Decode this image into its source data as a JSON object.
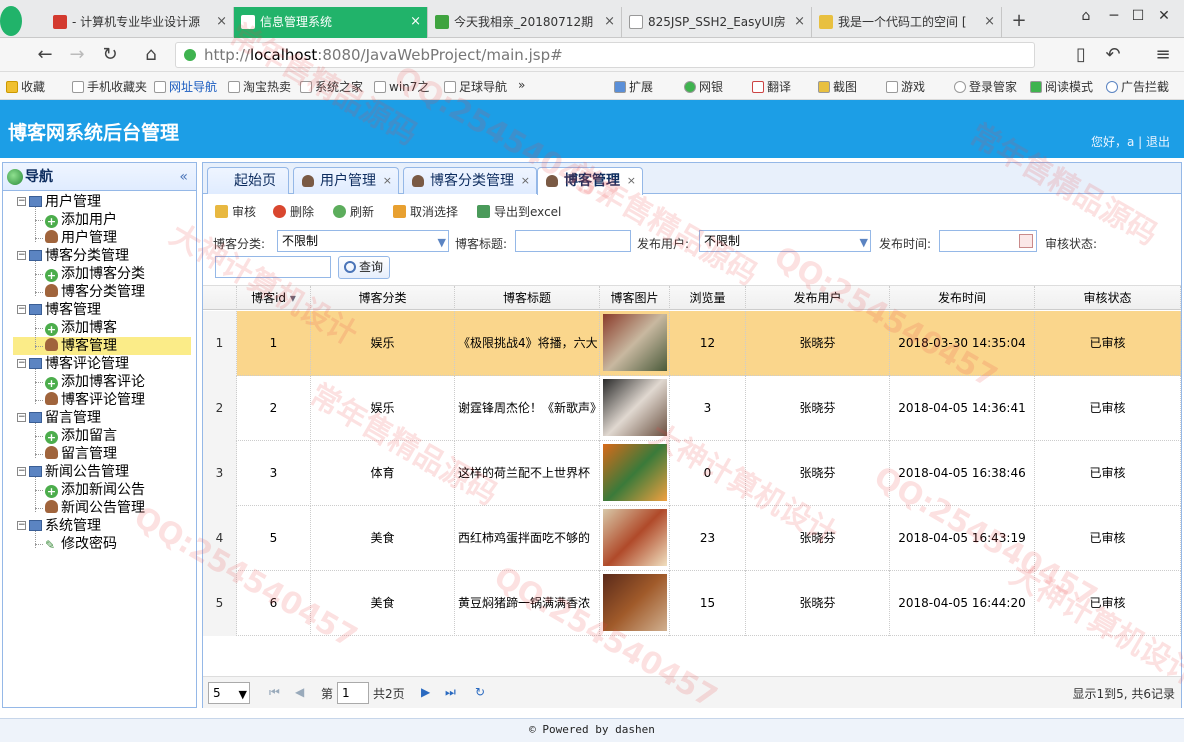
{
  "browser": {
    "tabs": [
      {
        "label": "- 计算机专业毕业设计源",
        "icon_color": "#d33a2f"
      },
      {
        "label": "信息管理系统",
        "icon_color": "#ffffff"
      },
      {
        "label": "今天我相亲_20180712期",
        "icon_color": "#3fa33f"
      },
      {
        "label": "825JSP_SSH2_EasyUI房",
        "icon_color": "#ffffff"
      },
      {
        "label": "我是一个代码工的空间 [",
        "icon_color": "#e8c040"
      }
    ],
    "new_tab": "+",
    "url_prefix": "http://",
    "url_host": "localhost",
    "url_rest": ":8080/JavaWebProject/main.jsp#",
    "bookmarks": [
      "收藏",
      "手机收藏夹",
      "网址导航",
      "淘宝热卖",
      "系统之家",
      "win7之",
      "足球导航",
      "»",
      "扩展",
      "网银",
      "翻译",
      "截图",
      "游戏",
      "登录管家",
      "阅读模式",
      "广告拦截"
    ]
  },
  "header": {
    "title": "博客网系统后台管理",
    "greeting": "您好，a | 退出"
  },
  "sidebar": {
    "title": "导航",
    "collapse": "«",
    "groups": [
      {
        "label": "用户管理",
        "items": [
          {
            "label": "添加用户",
            "icon": "add-icon"
          },
          {
            "label": "用户管理",
            "icon": "user-icon"
          }
        ]
      },
      {
        "label": "博客分类管理",
        "items": [
          {
            "label": "添加博客分类",
            "icon": "add-icon"
          },
          {
            "label": "博客分类管理",
            "icon": "user-icon"
          }
        ]
      },
      {
        "label": "博客管理",
        "items": [
          {
            "label": "添加博客",
            "icon": "add-icon"
          },
          {
            "label": "博客管理",
            "icon": "user-icon"
          }
        ]
      },
      {
        "label": "博客评论管理",
        "items": [
          {
            "label": "添加博客评论",
            "icon": "add-icon"
          },
          {
            "label": "博客评论管理",
            "icon": "user-icon"
          }
        ]
      },
      {
        "label": "留言管理",
        "items": [
          {
            "label": "添加留言",
            "icon": "add-icon"
          },
          {
            "label": "留言管理",
            "icon": "user-icon"
          }
        ]
      },
      {
        "label": "新闻公告管理",
        "items": [
          {
            "label": "添加新闻公告",
            "icon": "add-icon"
          },
          {
            "label": "新闻公告管理",
            "icon": "user-icon"
          }
        ]
      },
      {
        "label": "系统管理",
        "items": [
          {
            "label": "修改密码",
            "icon": "pencil-icon"
          }
        ]
      }
    ],
    "selected": "博客管理"
  },
  "main_tabs": [
    {
      "label": "起始页",
      "closable": false
    },
    {
      "label": "用户管理",
      "closable": true
    },
    {
      "label": "博客分类管理",
      "closable": true
    },
    {
      "label": "博客管理",
      "closable": true
    }
  ],
  "toolbar": [
    "审核",
    "删除",
    "刷新",
    "取消选择",
    "导出到excel"
  ],
  "search": {
    "category_label": "博客分类:",
    "category_value": "不限制",
    "title_label": "博客标题:",
    "title_value": "",
    "user_label": "发布用户:",
    "user_value": "不限制",
    "time_label": "发布时间:",
    "time_value": "",
    "status_label": "审核状态:",
    "status_value": "",
    "query_button": "查询"
  },
  "grid": {
    "columns": [
      "博客id",
      "博客分类",
      "博客标题",
      "博客图片",
      "浏览量",
      "发布用户",
      "发布时间",
      "审核状态"
    ],
    "sort_column": "博客id",
    "rows": [
      {
        "rownum": "1",
        "id": "1",
        "category": "娱乐",
        "title": "《极限挑战4》将播，六大",
        "views": "12",
        "user": "张晓芬",
        "time": "2018-03-30 14:35:04",
        "status": "已审核"
      },
      {
        "rownum": "2",
        "id": "2",
        "category": "娱乐",
        "title": "谢霆锋周杰伦！《新歌声》",
        "views": "3",
        "user": "张晓芬",
        "time": "2018-04-05 14:36:41",
        "status": "已审核"
      },
      {
        "rownum": "3",
        "id": "3",
        "category": "体育",
        "title": "这样的荷兰配不上世界杯",
        "views": "0",
        "user": "张晓芬",
        "time": "2018-04-05 16:38:46",
        "status": "已审核"
      },
      {
        "rownum": "4",
        "id": "5",
        "category": "美食",
        "title": "西红柿鸡蛋拌面吃不够的",
        "views": "23",
        "user": "张晓芬",
        "time": "2018-04-05 16:43:19",
        "status": "已审核"
      },
      {
        "rownum": "5",
        "id": "6",
        "category": "美食",
        "title": "黄豆焖猪蹄一锅满满香浓",
        "views": "15",
        "user": "张晓芬",
        "time": "2018-04-05 16:44:20",
        "status": "已审核"
      }
    ],
    "selected_row": 0
  },
  "pager": {
    "page_size": "5",
    "page_prefix": "第",
    "page_value": "1",
    "page_suffix": "共2页",
    "summary": "显示1到5, 共6记录"
  },
  "footer": "© Powered by dashen",
  "watermarks": [
    "QQ:254540457",
    "常年售精品源码",
    "大神计算机设计"
  ]
}
